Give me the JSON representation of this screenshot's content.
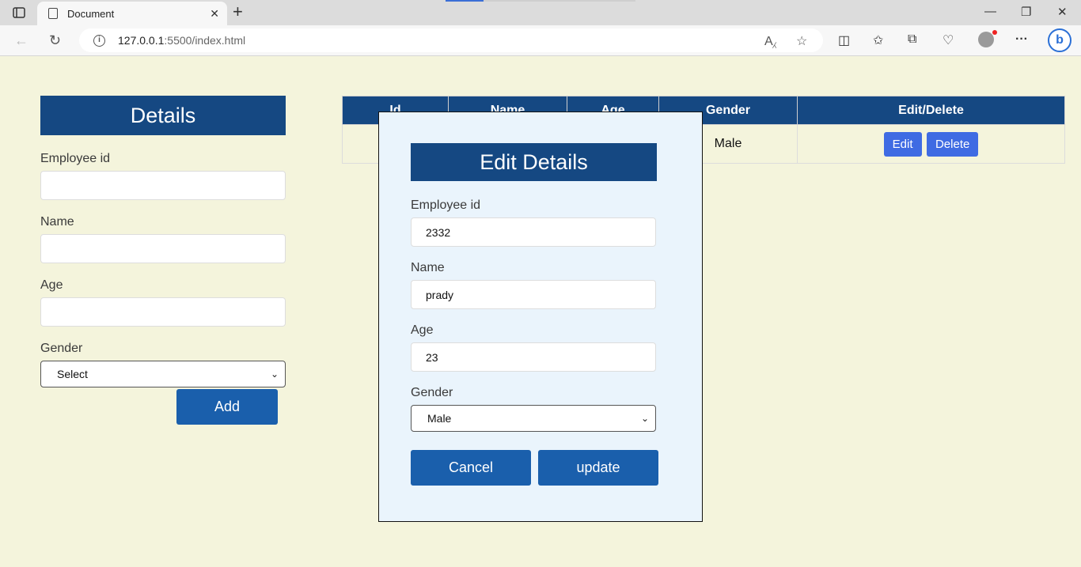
{
  "browser": {
    "tab_title": "Document",
    "url_host": "127.0.0.1",
    "url_path": ":5500/index.html"
  },
  "form": {
    "header": "Details",
    "employee_id_label": "Employee id",
    "name_label": "Name",
    "age_label": "Age",
    "gender_label": "Gender",
    "gender_value": "Select",
    "add_label": "Add"
  },
  "table": {
    "headers": [
      "Id",
      "Name",
      "Age",
      "Gender",
      "Edit/Delete"
    ],
    "rows": [
      {
        "gender": "Male",
        "edit_label": "Edit",
        "delete_label": "Delete"
      }
    ]
  },
  "modal": {
    "header": "Edit Details",
    "employee_id_label": "Employee id",
    "employee_id_value": "2332",
    "name_label": "Name",
    "name_value": "prady",
    "age_label": "Age",
    "age_value": "23",
    "gender_label": "Gender",
    "gender_value": "Male",
    "cancel_label": "Cancel",
    "update_label": "update"
  },
  "colors": {
    "header_blue": "#154882",
    "button_blue": "#1a5fac",
    "small_button_blue": "#3f6be3",
    "page_bg": "#f4f4dc",
    "modal_bg": "#eaf4fc"
  },
  "icons": [
    "sidebar-icon",
    "document-icon",
    "close-icon",
    "plus-icon",
    "back-icon",
    "refresh-icon",
    "info-icon",
    "read-aloud-icon",
    "star-icon",
    "split-screen-icon",
    "favorites-icon",
    "collections-icon",
    "performance-icon",
    "profile-icon",
    "more-icon",
    "bing-icon",
    "minimize-icon",
    "restore-icon"
  ]
}
